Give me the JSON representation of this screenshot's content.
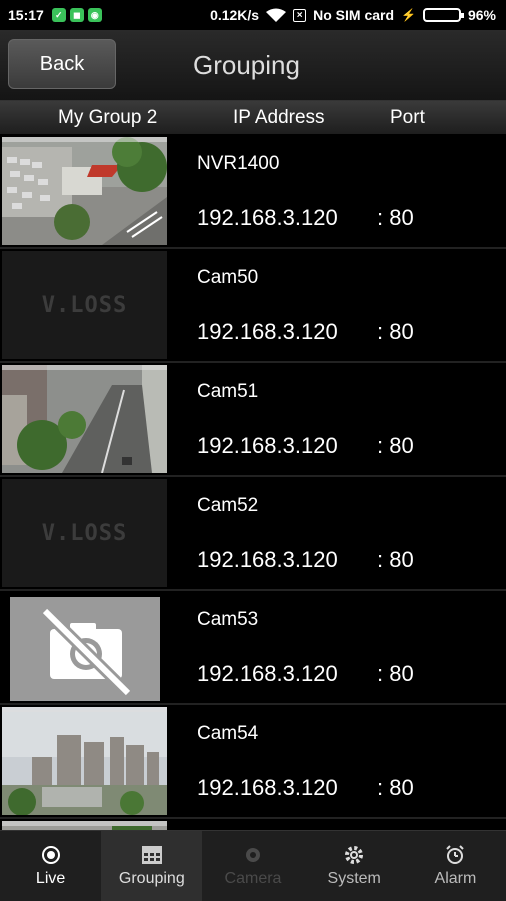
{
  "status_bar": {
    "time": "15:17",
    "speed": "0.12K/s",
    "sim": "No SIM card",
    "battery": "96%",
    "battery_level": 0.96
  },
  "header": {
    "back_label": "Back",
    "title": "Grouping"
  },
  "columns": {
    "group": "My Group 2",
    "ip": "IP Address",
    "port": "Port"
  },
  "devices": [
    {
      "name": "NVR1400",
      "ip": "192.168.3.120",
      "port": ": 80",
      "thumb": "street-parking"
    },
    {
      "name": "Cam50",
      "ip": "192.168.3.120",
      "port": ": 80",
      "thumb": "vloss"
    },
    {
      "name": "Cam51",
      "ip": "192.168.3.120",
      "port": ": 80",
      "thumb": "street-road"
    },
    {
      "name": "Cam52",
      "ip": "192.168.3.120",
      "port": ": 80",
      "thumb": "vloss"
    },
    {
      "name": "Cam53",
      "ip": "192.168.3.120",
      "port": ": 80",
      "thumb": "no-camera"
    },
    {
      "name": "Cam54",
      "ip": "192.168.3.120",
      "port": ": 80",
      "thumb": "city-skyline"
    }
  ],
  "vloss_text": "V.LOSS",
  "tabs": [
    {
      "label": "Live",
      "icon": "live-icon"
    },
    {
      "label": "Grouping",
      "icon": "grouping-icon"
    },
    {
      "label": "Camera",
      "icon": "camera-icon"
    },
    {
      "label": "System",
      "icon": "gear-icon"
    },
    {
      "label": "Alarm",
      "icon": "alarm-clock-icon"
    }
  ]
}
